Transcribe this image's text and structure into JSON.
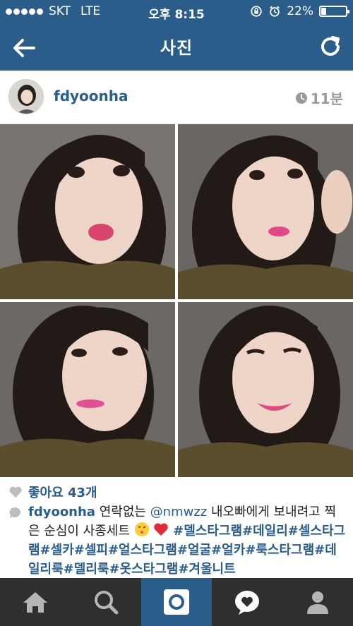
{
  "status_bar": {
    "carrier": "SKT",
    "network": "LTE",
    "time": "오후 8:15",
    "battery": "22%",
    "battery_level": 0.22
  },
  "nav": {
    "title": "사진",
    "back_icon": "arrow-left-icon",
    "refresh_icon": "refresh-icon"
  },
  "post": {
    "username": "fdyoonha",
    "time_ago": "11분",
    "likes": "좋아요 43개"
  },
  "caption": {
    "username": "fdyoonha",
    "part1": "연락없는 ",
    "mention": "@nmwzz",
    "part2": " 내오빠에게 보내려고 찍은 순심이 사종세트",
    "tags": "#델스타그램#데일리#셀스타그램#셀카#셀피#얼스타그램#얼굴#얼카#룩스타그램#데일리룩#델리룩#옷스타그램#겨울니트"
  },
  "tabs": [
    {
      "name": "home",
      "icon": "home-icon"
    },
    {
      "name": "search",
      "icon": "search-icon"
    },
    {
      "name": "camera",
      "icon": "camera-icon"
    },
    {
      "name": "activity",
      "icon": "heart-bubble-icon"
    },
    {
      "name": "profile",
      "icon": "profile-icon"
    }
  ],
  "colors": {
    "brand": "#2a5d8a",
    "tabbar": "#2f2f2f",
    "muted": "#9a9a9a"
  }
}
